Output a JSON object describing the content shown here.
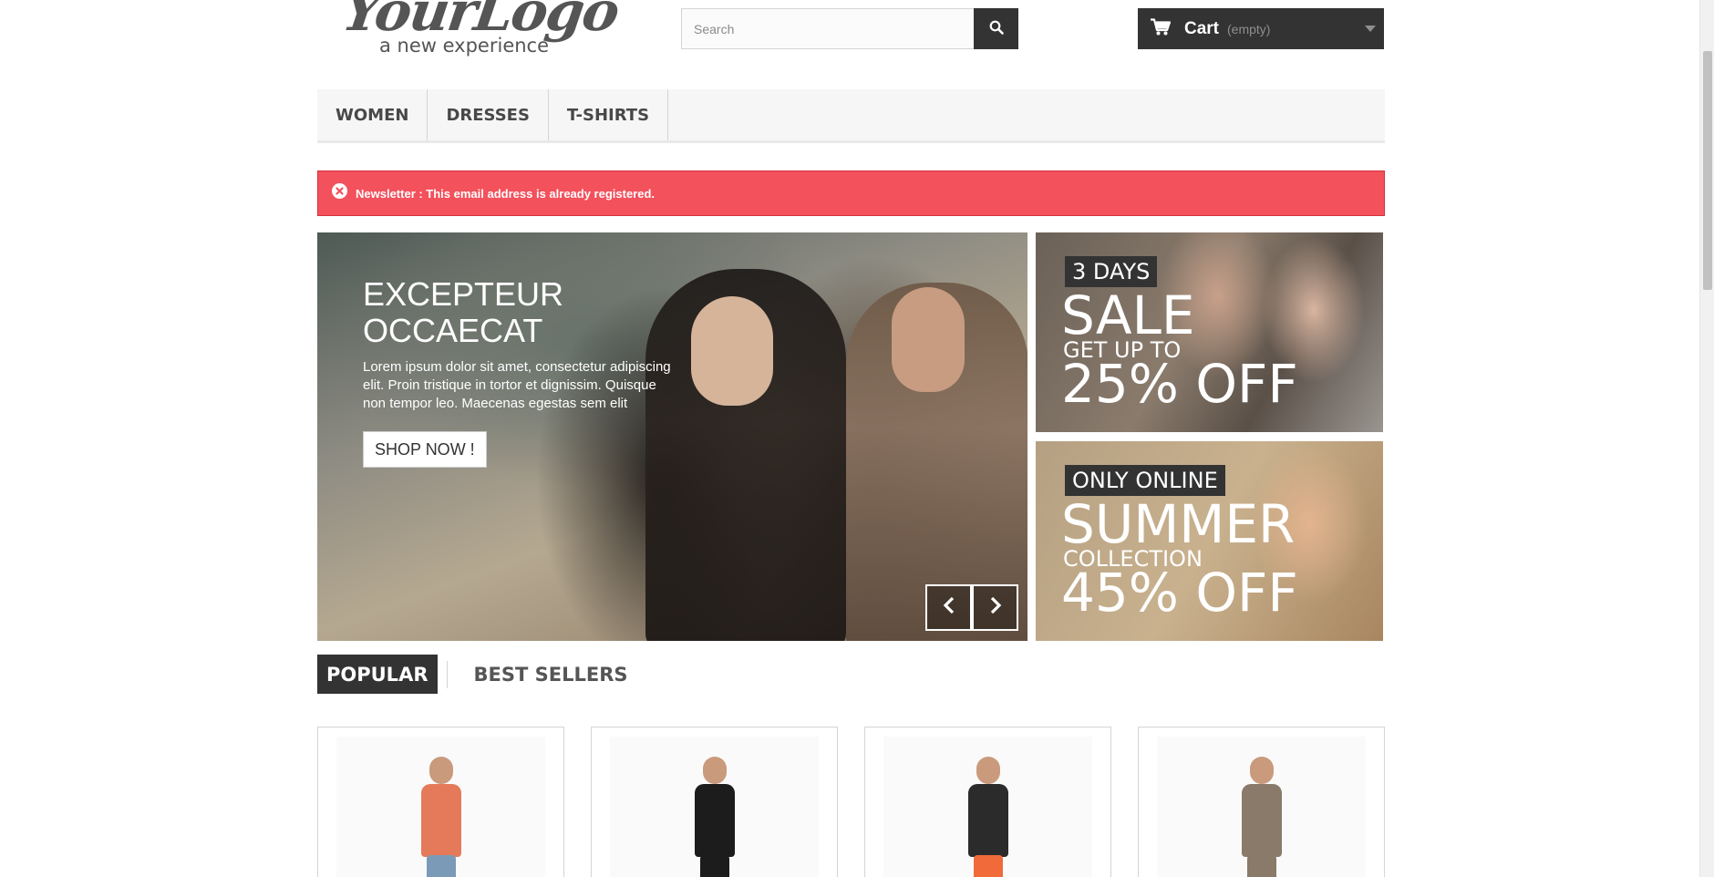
{
  "header": {
    "logo_brand": "YourLogo",
    "logo_tagline": "a new experience",
    "search_placeholder": "Search",
    "search_value": "",
    "cart_label": "Cart",
    "cart_qty": "(empty)"
  },
  "menu": {
    "items": [
      {
        "label": "WOMEN"
      },
      {
        "label": "DRESSES"
      },
      {
        "label": "T-SHIRTS"
      }
    ]
  },
  "alert": {
    "text": "Newsletter : This email address is already registered.",
    "color": "#f3515c"
  },
  "slider": {
    "title": "EXCEPTEUR OCCAECAT",
    "text": "Lorem ipsum dolor sit amet, consectetur adipiscing elit. Proin tristique in tortor et dignissim. Quisque non tempor leo. Maecenas egestas sem elit",
    "button": "SHOP NOW !",
    "prev_icon": "chevron-left-icon",
    "next_icon": "chevron-right-icon"
  },
  "banners": [
    {
      "tag": "3 DAYS",
      "big": "SALE",
      "mid": "GET UP TO",
      "big2": "25% OFF"
    },
    {
      "tag": "ONLY ONLINE",
      "big": "SUMMER",
      "mid": "COLLECTION",
      "big2": "45% OFF"
    }
  ],
  "tabs": {
    "popular": "POPULAR",
    "best_sellers": "BEST SELLERS"
  },
  "products": [
    {
      "top_color": "#e57a5a",
      "bottom_color": "#7a9ab8"
    },
    {
      "top_color": "#1c1c1c",
      "bottom_color": "#1c1c1c"
    },
    {
      "top_color": "#2b2b2b",
      "bottom_color": "#f06a3a"
    },
    {
      "top_color": "#8a7a6a",
      "bottom_color": "#8a7a6a"
    }
  ],
  "colors": {
    "dark": "#333333",
    "menu_bg": "#f6f6f6",
    "alert": "#f3515c"
  }
}
